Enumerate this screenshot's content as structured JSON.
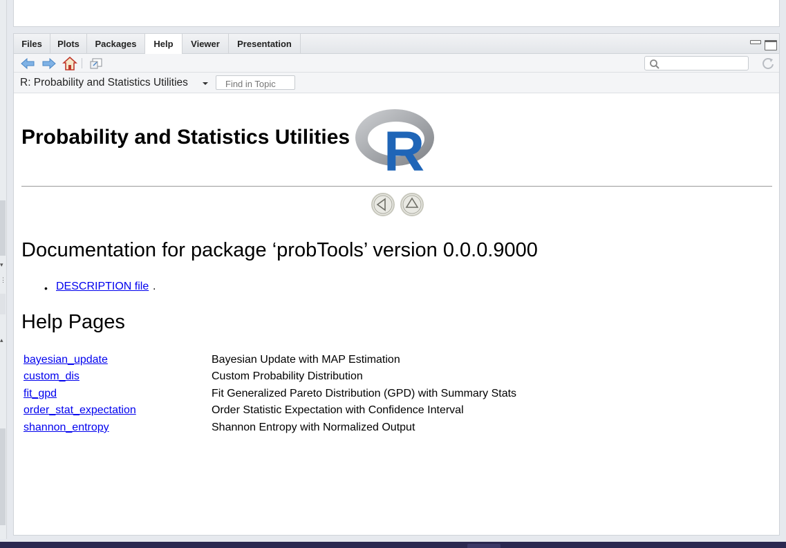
{
  "tabs": [
    {
      "label": "Files"
    },
    {
      "label": "Plots"
    },
    {
      "label": "Packages"
    },
    {
      "label": "Help"
    },
    {
      "label": "Viewer"
    },
    {
      "label": "Presentation"
    }
  ],
  "active_tab": "Help",
  "toolbar": {
    "icons": [
      "back-arrow-icon",
      "forward-arrow-icon",
      "home-icon",
      "popout-window-icon",
      "search-icon",
      "refresh-icon"
    ],
    "search_value": ""
  },
  "topic": {
    "selected": "R: Probability and Statistics Utilities",
    "find_placeholder": "Find in Topic"
  },
  "doc": {
    "title": "Probability and Statistics Utilities",
    "logo_text": "R",
    "heading": "Documentation for package ‘probTools’ version 0.0.0.9000",
    "description_link": "DESCRIPTION file",
    "description_suffix": ".",
    "help_heading": "Help Pages",
    "help_pages": [
      {
        "name": "bayesian_update",
        "title": "Bayesian Update with MAP Estimation"
      },
      {
        "name": "custom_dis",
        "title": "Custom Probability Distribution"
      },
      {
        "name": "fit_gpd",
        "title": "Fit Generalized Pareto Distribution (GPD) with Summary Stats"
      },
      {
        "name": "order_stat_expectation",
        "title": "Order Statistic Expectation with Confidence Interval"
      },
      {
        "name": "shannon_entropy",
        "title": "Shannon Entropy with Normalized Output"
      }
    ]
  },
  "colors": {
    "link": "#0000ee",
    "r_logo_blue": "#1f65b7",
    "r_logo_gray": "#8e9094"
  }
}
